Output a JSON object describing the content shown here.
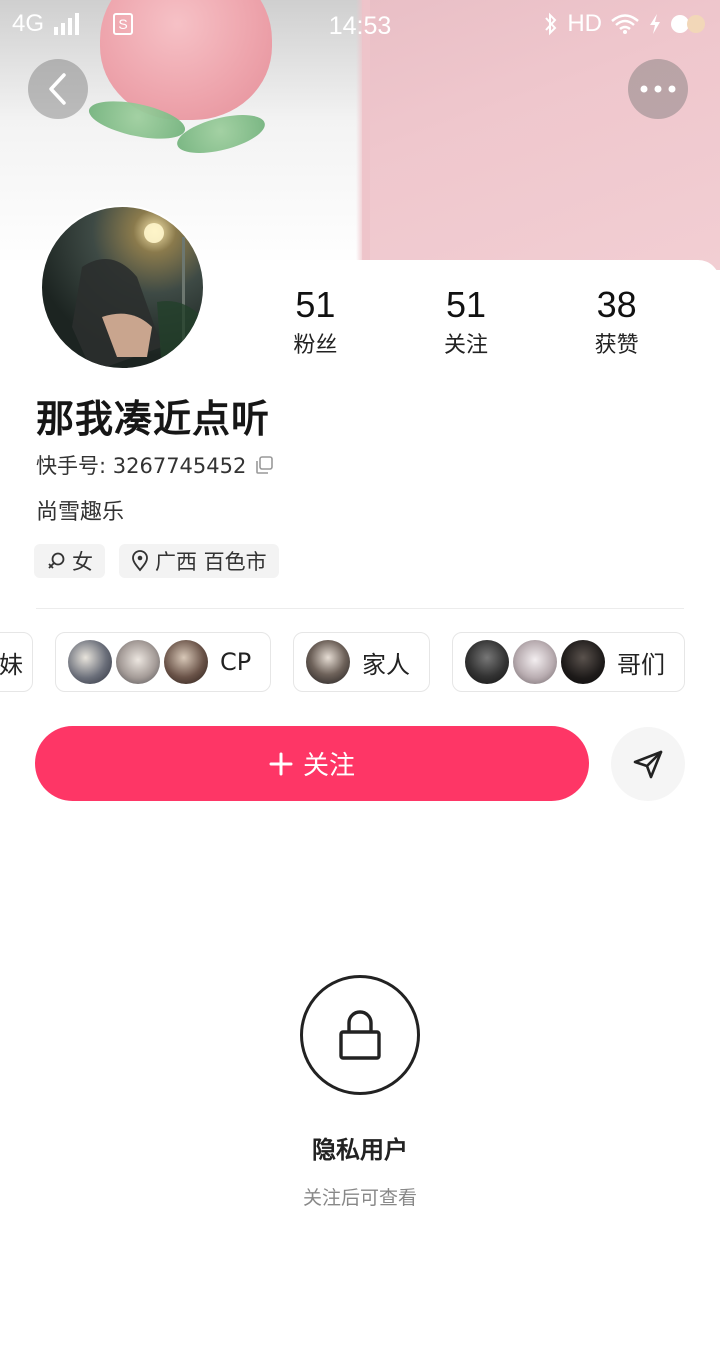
{
  "status_bar": {
    "network": "4G",
    "time": "14:53",
    "hd_label": "HD"
  },
  "profile": {
    "nickname": "那我凑近点听",
    "kuaishou_id": "快手号: 3267745452",
    "bio": "尚雪趣乐",
    "tags": {
      "gender": "女",
      "location": "广西 百色市"
    },
    "stats": [
      {
        "value": "51",
        "label": "粉丝"
      },
      {
        "value": "51",
        "label": "关注"
      },
      {
        "value": "38",
        "label": "获赞"
      }
    ]
  },
  "groups": [
    {
      "label": "妹"
    },
    {
      "label": "CP"
    },
    {
      "label": "家人"
    },
    {
      "label": "哥们"
    }
  ],
  "actions": {
    "follow_label": "关注",
    "follow_plus": "+"
  },
  "privacy": {
    "title": "隐私用户",
    "subtitle": "关注后可查看"
  },
  "colors": {
    "accent": "#fe3666",
    "cover_pink": "#efc7cd"
  },
  "icons": [
    "back-arrow-icon",
    "more-dots-icon",
    "copy-icon",
    "gender-female-icon",
    "location-pin-icon",
    "send-arrow-icon",
    "lock-icon"
  ]
}
